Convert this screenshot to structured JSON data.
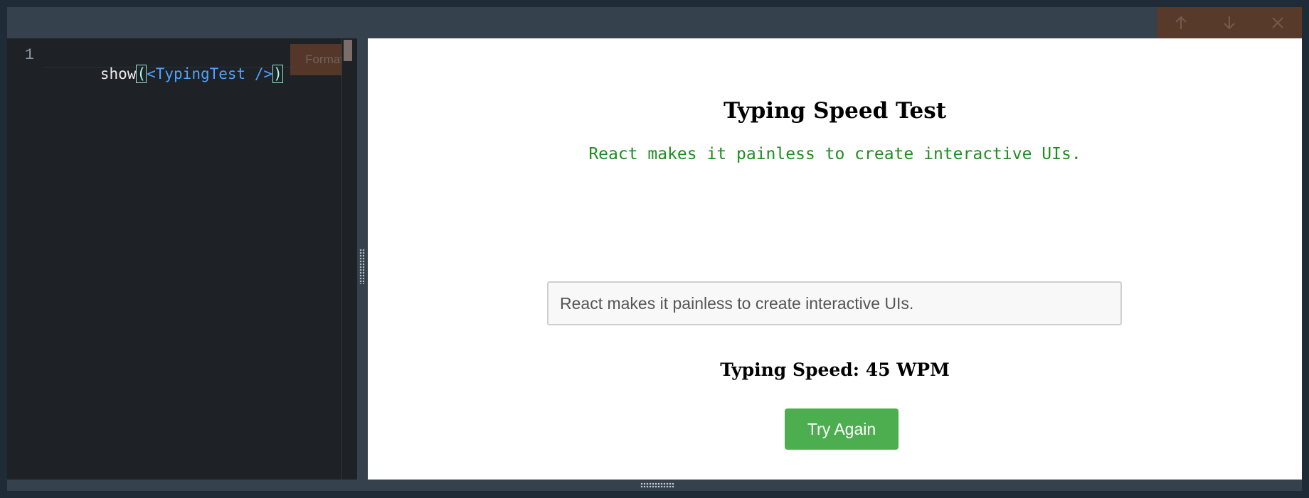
{
  "editor": {
    "line_number": "1",
    "code": {
      "prefix": "show",
      "open_paren": "(",
      "jsx_open": "<",
      "component": "TypingTest",
      "self_close": " />",
      "close_paren": ")"
    },
    "format_label": "Format"
  },
  "controls": {
    "up_icon": "arrow-up-icon",
    "down_icon": "arrow-down-icon",
    "close_icon": "close-icon"
  },
  "preview": {
    "title": "Typing Speed Test",
    "sample_sentence": "React makes it painless to create interactive UIs.",
    "input_value": "React makes it painless to create interactive UIs.",
    "speed_result": "Typing Speed: 45 WPM",
    "try_again_label": "Try Again"
  },
  "colors": {
    "outer_background": "#1f2b37",
    "panel_background": "#35414c",
    "editor_background": "#1e2125",
    "jsx_blue": "#4ea3ff",
    "green_text": "#1f8d1f",
    "button_green": "#4cae4f",
    "control_brown": "#5a3a2a"
  }
}
